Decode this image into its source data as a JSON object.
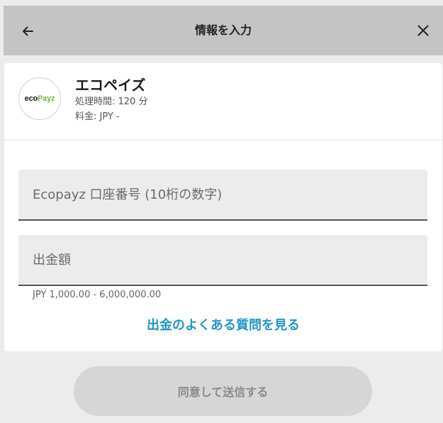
{
  "header": {
    "title": "情報を入力",
    "back_icon": "arrow-left-icon",
    "close_icon": "close-icon"
  },
  "method": {
    "logo_text_part1": "eco",
    "logo_text_part2": "Payz",
    "name": "エコペイズ",
    "processing_time": "処理時間: 120 分",
    "fee": "料金: JPY -"
  },
  "form": {
    "account_placeholder": "Ecopayz 口座番号 (10桁の数字)",
    "account_value": "",
    "amount_placeholder": "出金額",
    "amount_value": "",
    "amount_range": "JPY 1,000.00 - 6,000,000.00"
  },
  "faq_link": "出金のよくある質問を見る",
  "submit_label": "同意して送信する",
  "colors": {
    "header_bg": "#c4c4c4",
    "link": "#2196c9",
    "logo_green": "#7cb342",
    "button_disabled": "#d6d6d6"
  }
}
